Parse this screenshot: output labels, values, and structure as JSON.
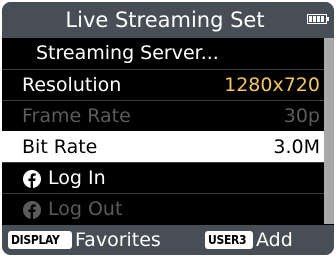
{
  "header": {
    "title": "Live Streaming Set"
  },
  "menu": {
    "streaming_server": "Streaming Server...",
    "resolution_label": "Resolution",
    "resolution_value": "1280x720",
    "frame_rate_label": "Frame Rate",
    "frame_rate_value": "30p",
    "bit_rate_label": "Bit Rate",
    "bit_rate_value": "3.0M",
    "log_in": "Log In",
    "log_out": "Log Out"
  },
  "footer": {
    "display_key": "DISPLAY",
    "display_action": "Favorites",
    "user_key": "USER3",
    "user_action": "Add"
  },
  "colors": {
    "header_bg": "#474e55",
    "value_highlight": "#f3c561",
    "disabled_text": "#5b5b5b"
  },
  "icons": [
    "battery-icon",
    "facebook-icon"
  ]
}
